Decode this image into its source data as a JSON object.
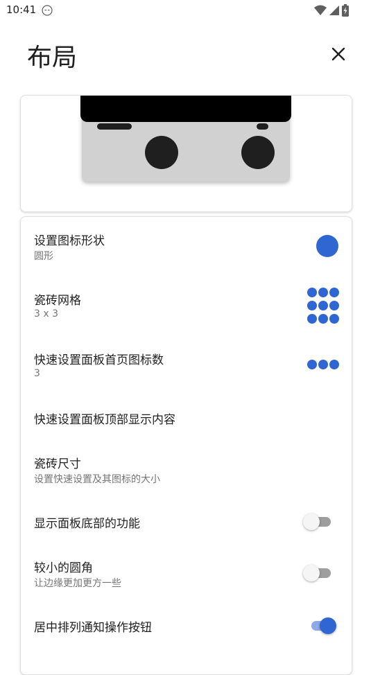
{
  "status": {
    "time": "10:41"
  },
  "header": {
    "title": "布局"
  },
  "settings": [
    {
      "title": "设置图标形状",
      "subtitle": "圆形"
    },
    {
      "title": "瓷砖网格",
      "subtitle": "3 x 3"
    },
    {
      "title": "快速设置面板首页图标数",
      "subtitle": "3"
    },
    {
      "title": "快速设置面板顶部显示内容"
    },
    {
      "title": "瓷砖尺寸",
      "subtitle": "设置快速设置及其图标的大小"
    },
    {
      "title": "显示面板底部的功能",
      "toggle": false
    },
    {
      "title": "较小的圆角",
      "subtitle": "让边缘更加更方一些",
      "toggle": false
    },
    {
      "title": "居中排列通知操作按钮",
      "toggle": true
    }
  ],
  "colors": {
    "accent": "#3066d1",
    "text": "#1f1f1f",
    "subtext": "#757575"
  }
}
